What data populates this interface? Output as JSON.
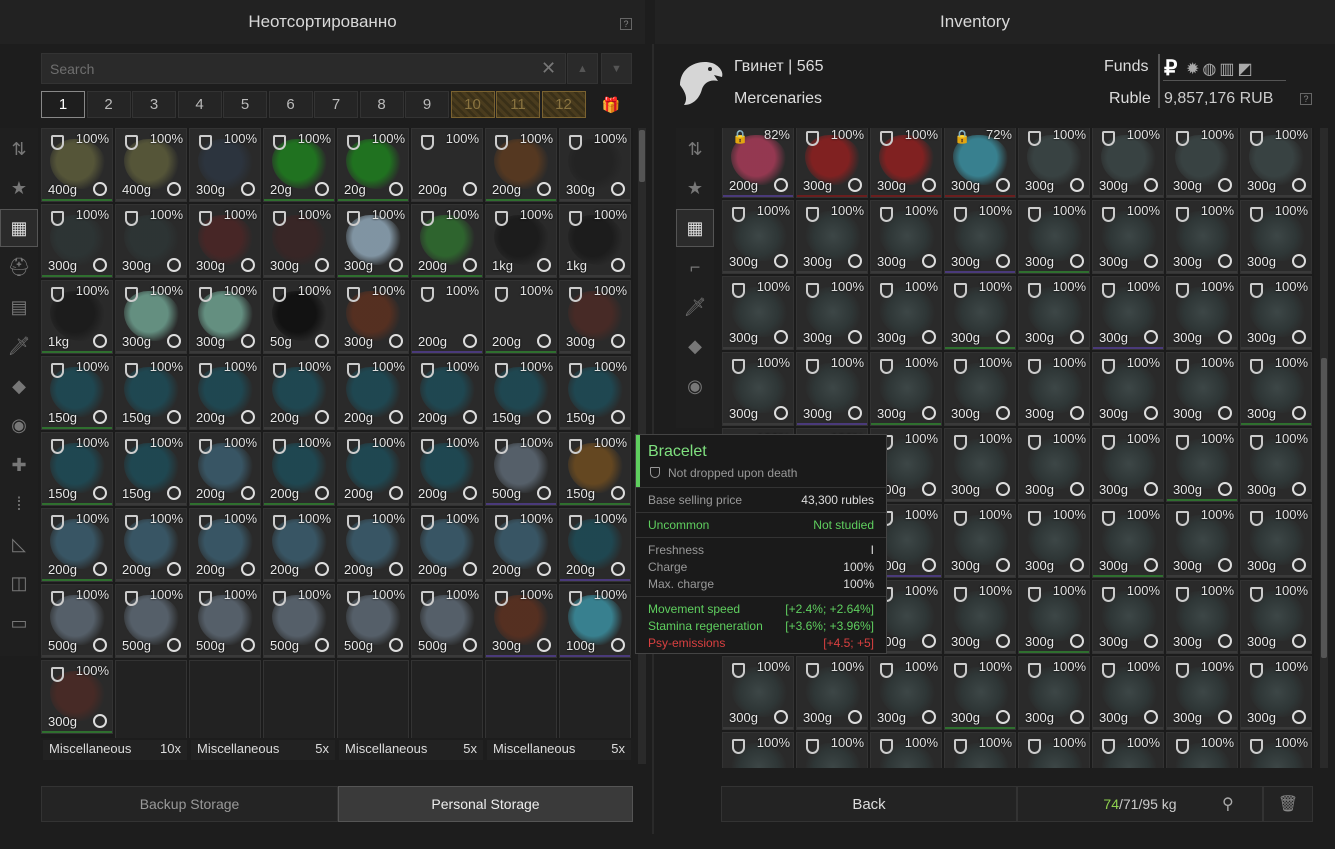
{
  "left_panel": {
    "title": "Неотсортированно",
    "help": "?",
    "search_placeholder": "Search",
    "clear_icon": "close-icon",
    "page_tabs": [
      "1",
      "2",
      "3",
      "4",
      "5",
      "6",
      "7",
      "8",
      "9",
      "10",
      "11",
      "12"
    ],
    "active_page": "1",
    "locked_pages": [
      "10",
      "11",
      "12"
    ],
    "gift_icon": "gift-icon",
    "categories": [
      {
        "name": "sort-icon",
        "glyph": "⇅"
      },
      {
        "name": "favorites-star-icon",
        "glyph": "★"
      },
      {
        "name": "grid-all-icon",
        "glyph": "▦",
        "active": true
      },
      {
        "name": "helmet-icon",
        "glyph": "⛑"
      },
      {
        "name": "armor-icon",
        "glyph": "▤"
      },
      {
        "name": "knife-icon",
        "glyph": "🗡"
      },
      {
        "name": "grenade-icon",
        "glyph": "◆"
      },
      {
        "name": "artifact-icon",
        "glyph": "◉"
      },
      {
        "name": "medkit-icon",
        "glyph": "✚"
      },
      {
        "name": "ammo-icon",
        "glyph": "⁞"
      },
      {
        "name": "tools-icon",
        "glyph": "◺"
      },
      {
        "name": "container-icon",
        "glyph": "◫"
      },
      {
        "name": "storage-box-icon",
        "glyph": "▭"
      }
    ],
    "items": [
      {
        "pct": "100%",
        "wt": "400g",
        "color": "#5a5a3a",
        "bar": "#3a3a3a"
      },
      {
        "pct": "100%",
        "wt": "400g",
        "color": "#5a5a3a",
        "bar": "#3a3a3a"
      },
      {
        "pct": "100%",
        "wt": "300g",
        "color": "#2c3540",
        "bar": "#3a3a3a"
      },
      {
        "pct": "100%",
        "wt": "20g",
        "color": "#1f7a1f",
        "bar": "#3a3a3a"
      },
      {
        "pct": "100%",
        "wt": "20g",
        "color": "#1f7a1f",
        "bar": "#3a3a3a"
      },
      {
        "pct": "100%",
        "wt": "200g",
        "color": "#2a2a2a",
        "bar": "#3a3a3a"
      },
      {
        "pct": "100%",
        "wt": "200g",
        "color": "#5a3a20",
        "bar": "#3a3a3a"
      },
      {
        "pct": "100%",
        "wt": "300g",
        "color": "#222",
        "bar": "#3a3a3a"
      },
      {
        "pct": "100%",
        "wt": "300g",
        "color": "#2d3535",
        "bar": "#3a3a3a"
      },
      {
        "pct": "100%",
        "wt": "300g",
        "color": "#2d3535",
        "bar": "#3a3a3a"
      },
      {
        "pct": "100%",
        "wt": "300g",
        "color": "#4a2626",
        "bar": "#3a3a3a"
      },
      {
        "pct": "100%",
        "wt": "300g",
        "color": "#3a2525",
        "bar": "#3a3a3a"
      },
      {
        "pct": "100%",
        "wt": "300g",
        "color": "#8aa0b0",
        "bar": "#3a3a3a"
      },
      {
        "pct": "100%",
        "wt": "200g",
        "color": "#2f6a2f",
        "bar": "#3a3a3a"
      },
      {
        "pct": "100%",
        "wt": "1kg",
        "color": "#1a1a1a",
        "bar": "#3a3a3a"
      },
      {
        "pct": "100%",
        "wt": "1kg",
        "color": "#1a1a1a",
        "bar": "#3a3a3a"
      },
      {
        "pct": "100%",
        "wt": "1kg",
        "color": "#1a1a1a",
        "bar": "#3a3a3a"
      },
      {
        "pct": "100%",
        "wt": "300g",
        "color": "#6a9a8a",
        "bar": "#3a3a3a"
      },
      {
        "pct": "100%",
        "wt": "300g",
        "color": "#6a9a8a",
        "bar": "#3a3a3a"
      },
      {
        "pct": "100%",
        "wt": "50g",
        "color": "#0f0f0f",
        "bar": "#3a3a3a"
      },
      {
        "pct": "100%",
        "wt": "300g",
        "color": "#5a3020",
        "bar": "#3a3a3a"
      },
      {
        "pct": "100%",
        "wt": "200g",
        "color": "#2a2a2a",
        "bar": "#3a3a3a"
      },
      {
        "pct": "100%",
        "wt": "200g",
        "color": "#2a2a2a",
        "bar": "#3a3a3a"
      },
      {
        "pct": "100%",
        "wt": "300g",
        "color": "#4a2a25",
        "bar": "#3a3a3a"
      },
      {
        "pct": "100%",
        "wt": "150g",
        "color": "#1e4a55",
        "bar": "#3a3a3a"
      },
      {
        "pct": "100%",
        "wt": "150g",
        "color": "#1e4a55",
        "bar": "#3a3a3a"
      },
      {
        "pct": "100%",
        "wt": "200g",
        "color": "#1e4a55",
        "bar": "#3a3a3a"
      },
      {
        "pct": "100%",
        "wt": "200g",
        "color": "#1e4a55",
        "bar": "#3a3a3a"
      },
      {
        "pct": "100%",
        "wt": "200g",
        "color": "#1e4a55",
        "bar": "#3a3a3a"
      },
      {
        "pct": "100%",
        "wt": "200g",
        "color": "#1e4a55",
        "bar": "#3a3a3a"
      },
      {
        "pct": "100%",
        "wt": "150g",
        "color": "#1e4a55",
        "bar": "#3a3a3a"
      },
      {
        "pct": "100%",
        "wt": "150g",
        "color": "#1e4a55",
        "bar": "#3a3a3a"
      },
      {
        "pct": "100%",
        "wt": "150g",
        "color": "#1e4a55",
        "bar": "#3a3a3a"
      },
      {
        "pct": "100%",
        "wt": "150g",
        "color": "#1e4a55",
        "bar": "#3a3a3a"
      },
      {
        "pct": "100%",
        "wt": "200g",
        "color": "#3a5a6a",
        "bar": "#3a3a3a"
      },
      {
        "pct": "100%",
        "wt": "200g",
        "color": "#1e4a55",
        "bar": "#3a3a3a"
      },
      {
        "pct": "100%",
        "wt": "200g",
        "color": "#1e4a55",
        "bar": "#3a3a3a"
      },
      {
        "pct": "100%",
        "wt": "200g",
        "color": "#1e4a55",
        "bar": "#3a3a3a"
      },
      {
        "pct": "100%",
        "wt": "500g",
        "color": "#5a6570",
        "bar": "#3a3a3a"
      },
      {
        "pct": "100%",
        "wt": "150g",
        "color": "#6a4a20",
        "bar": "#3a3a3a"
      },
      {
        "pct": "100%",
        "wt": "200g",
        "color": "#3a5a6a",
        "bar": "#3a3a3a"
      },
      {
        "pct": "100%",
        "wt": "200g",
        "color": "#3a5a6a",
        "bar": "#3a3a3a"
      },
      {
        "pct": "100%",
        "wt": "200g",
        "color": "#3a5a6a",
        "bar": "#3a3a3a"
      },
      {
        "pct": "100%",
        "wt": "200g",
        "color": "#3a5a6a",
        "bar": "#3a3a3a"
      },
      {
        "pct": "100%",
        "wt": "200g",
        "color": "#3a5a6a",
        "bar": "#3a3a3a"
      },
      {
        "pct": "100%",
        "wt": "200g",
        "color": "#3a5a6a",
        "bar": "#3a3a3a"
      },
      {
        "pct": "100%",
        "wt": "200g",
        "color": "#3a5a6a",
        "bar": "#3a3a3a"
      },
      {
        "pct": "100%",
        "wt": "200g",
        "color": "#1e4a55",
        "bar": "#3a3a3a"
      },
      {
        "pct": "100%",
        "wt": "500g",
        "color": "#5a6570",
        "bar": "#3a3a3a"
      },
      {
        "pct": "100%",
        "wt": "500g",
        "color": "#5a6570",
        "bar": "#3a3a3a"
      },
      {
        "pct": "100%",
        "wt": "500g",
        "color": "#5a6570",
        "bar": "#3a3a3a"
      },
      {
        "pct": "100%",
        "wt": "500g",
        "color": "#5a6570",
        "bar": "#3a3a3a"
      },
      {
        "pct": "100%",
        "wt": "500g",
        "color": "#5a6570",
        "bar": "#3a3a3a"
      },
      {
        "pct": "100%",
        "wt": "500g",
        "color": "#5a6570",
        "bar": "#3a3a3a"
      },
      {
        "pct": "100%",
        "wt": "300g",
        "color": "#5a3020",
        "bar": "#3a3a3a"
      },
      {
        "pct": "100%",
        "wt": "100g",
        "color": "#3a8a9a",
        "bar": "#3a3a3a"
      },
      {
        "pct": "100%",
        "wt": "300g",
        "color": "#4a2a25",
        "bar": "#3a3a3a"
      }
    ],
    "bar_colors": [
      "#2f6f2f",
      "#3a3a3a",
      "#3a3a3a",
      "#2f6f2f",
      "#2f6f2f",
      "#3a3a3a",
      "#2f6f2f",
      "#3a3a3a",
      "#2f6f2f",
      "#3a3a3a",
      "#3a3a3a",
      "#3a3a3a",
      "#2f6f2f",
      "#2f6f2f",
      "#3a3a3a",
      "#3a3a3a",
      "#2f6f2f",
      "#3a3a3a",
      "#3a3a3a",
      "#3a3a3a",
      "#3a3a3a",
      "#4a3a7a",
      "#2f6f2f",
      "#3a3a3a",
      "#2f6f2f",
      "#3a3a3a",
      "#3a3a3a",
      "#3a3a3a",
      "#3a3a3a",
      "#3a3a3a",
      "#3a3a3a",
      "#3a3a3a",
      "#2f6f2f",
      "#3a3a3a",
      "#2f6f2f",
      "#2f6f2f",
      "#3a3a3a",
      "#3a3a3a",
      "#4a3a7a",
      "#2f6f2f",
      "#2f6f2f",
      "#3a3a3a",
      "#3a3a3a",
      "#3a3a3a",
      "#3a3a3a",
      "#3a3a3a",
      "#3a3a3a",
      "#4a3a7a",
      "#3a3a3a",
      "#3a3a3a",
      "#3a3a3a",
      "#3a3a3a",
      "#3a3a3a",
      "#3a3a3a",
      "#4a3a7a",
      "#4a3a7a",
      "#2f6f2f"
    ],
    "misc": [
      {
        "label": "Miscellaneous",
        "count": "10x"
      },
      {
        "label": "Miscellaneous",
        "count": "5x"
      },
      {
        "label": "Miscellaneous",
        "count": "5x"
      },
      {
        "label": "Miscellaneous",
        "count": "5x"
      }
    ],
    "bottom_tabs": {
      "backup": "Backup Storage",
      "personal": "Personal Storage"
    }
  },
  "right_panel": {
    "title": "Inventory",
    "player": "Гвинет | 565",
    "faction": "Mercenaries",
    "funds_label": "Funds",
    "currency_label": "Ruble",
    "currency_symbol": "₽",
    "funds_value": "9,857,176 RUB",
    "help": "?",
    "currency_icons": [
      "ruble-icon",
      "gear-coin-icon",
      "compass-coin-icon",
      "cash-icon",
      "voucher-icon"
    ],
    "categories": [
      {
        "name": "sort-icon",
        "glyph": "⇅"
      },
      {
        "name": "favorites-star-icon",
        "glyph": "★"
      },
      {
        "name": "grid-all-icon",
        "glyph": "▦",
        "active": true
      },
      {
        "name": "rifle-icon",
        "glyph": "⌐"
      },
      {
        "name": "knife-icon",
        "glyph": "🗡"
      },
      {
        "name": "grenade-icon",
        "glyph": "◆"
      },
      {
        "name": "artifact-icon",
        "glyph": "◉"
      }
    ],
    "first_row": [
      {
        "pct": "82%",
        "wt": "200g",
        "color": "#a03a55",
        "lock": true,
        "bar": "#4a3a7a"
      },
      {
        "pct": "100%",
        "wt": "300g",
        "color": "#8a2020",
        "lock": false,
        "bar": "#6a1e1e"
      },
      {
        "pct": "100%",
        "wt": "300g",
        "color": "#8a2020",
        "lock": false,
        "bar": "#6a1e1e"
      },
      {
        "pct": "72%",
        "wt": "300g",
        "color": "#3a8a9a",
        "lock": true,
        "bar": "#6a1e1e"
      },
      {
        "pct": "100%",
        "wt": "300g",
        "color": "#3a4545",
        "lock": false,
        "bar": "#3a3a3a"
      },
      {
        "pct": "100%",
        "wt": "300g",
        "color": "#3a4545",
        "lock": false,
        "bar": "#3a3a3a"
      },
      {
        "pct": "100%",
        "wt": "300g",
        "color": "#3a4545",
        "lock": false,
        "bar": "#3a3a3a"
      },
      {
        "pct": "100%",
        "wt": "300g",
        "color": "#3a4545",
        "lock": false,
        "bar": "#3a3a3a"
      }
    ],
    "generic_pct": "100%",
    "generic_wt": "300g",
    "weight_current": "74",
    "weight_rest": "/71/95 kg",
    "back": "Back",
    "kettlebell_icon": "kettlebell-icon",
    "trash_icon": "trash-icon"
  },
  "tooltip": {
    "name": "Bracelet",
    "note": "Not dropped upon death",
    "price_label": "Base selling price",
    "price_value": "43,300 rubles",
    "rarity": "Uncommon",
    "studied": "Not studied",
    "freshness_label": "Freshness",
    "freshness_value": "I",
    "charge_label": "Charge",
    "charge_value": "100%",
    "maxcharge_label": "Max. charge",
    "maxcharge_value": "100%",
    "stats": [
      {
        "label": "Movement speed",
        "value": "[+2.4%; +2.64%]",
        "color": "#5fcf5f"
      },
      {
        "label": "Stamina regeneration",
        "value": "[+3.6%; +3.96%]",
        "color": "#5fcf5f"
      },
      {
        "label": "Psy-emissions",
        "value": "[+4.5; +5]",
        "color": "#d94040"
      }
    ]
  }
}
